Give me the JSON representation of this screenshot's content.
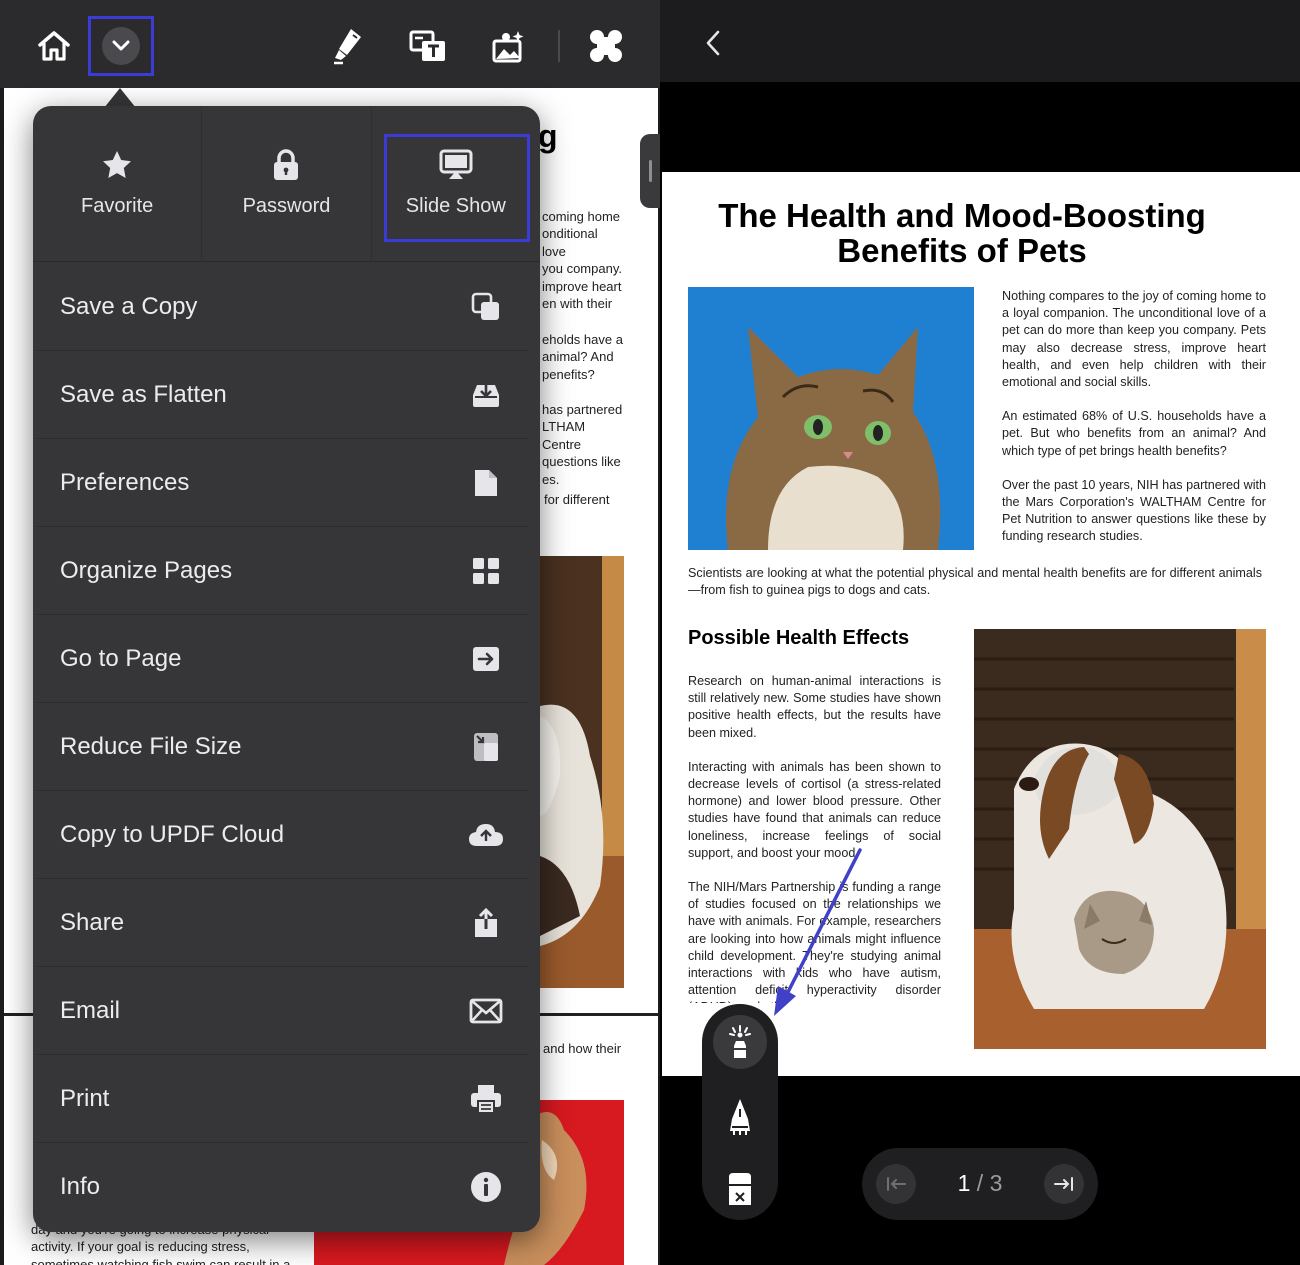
{
  "menu": {
    "top": [
      {
        "label": "Favorite",
        "icon": "star-icon"
      },
      {
        "label": "Password",
        "icon": "lock-icon"
      },
      {
        "label": "Slide Show",
        "icon": "slideshow-icon"
      }
    ],
    "items": [
      {
        "label": "Save a Copy",
        "icon": "copy-icon"
      },
      {
        "label": "Save as Flatten",
        "icon": "flatten-icon"
      },
      {
        "label": "Preferences",
        "icon": "document-icon"
      },
      {
        "label": "Organize Pages",
        "icon": "grid-icon"
      },
      {
        "label": "Go to Page",
        "icon": "go-to-page-icon"
      },
      {
        "label": "Reduce File Size",
        "icon": "reduce-size-icon"
      },
      {
        "label": "Copy to UPDF Cloud",
        "icon": "cloud-icon"
      },
      {
        "label": "Share",
        "icon": "share-icon"
      },
      {
        "label": "Email",
        "icon": "mail-icon"
      },
      {
        "label": "Print",
        "icon": "printer-icon"
      },
      {
        "label": "Info",
        "icon": "info-icon"
      }
    ]
  },
  "left_doc": {
    "heading_fragment": "g",
    "para1": [
      "coming home",
      "onditional love",
      "you company.",
      "improve heart",
      "en with their"
    ],
    "para2": [
      "eholds have a",
      "animal? And",
      "penefits?"
    ],
    "para3": [
      "has partnered",
      "LTHAM Centre",
      "questions like",
      "es."
    ],
    "para4": "for different",
    "para5": "and how their",
    "bottom1": "day and you're going to increase physical",
    "bottom2": "activity. If your goal is reducing stress,",
    "bottom3": "sometimes watching fish swim can result in a"
  },
  "document": {
    "title": "The Health and Mood-Boosting Benefits of Pets",
    "intro_paragraphs": [
      "Nothing compares to the joy of coming home to a loyal companion. The unconditional love of a pet can do more than keep you company. Pets may also decrease stress, improve heart health, and even help children with their emotional and social skills.",
      "An estimated 68% of U.S. households have a pet. But who benefits from an animal? And which type of pet brings health benefits?",
      "Over the past 10 years, NIH has partnered with the Mars Corporation's WALTHAM Centre for Pet Nutrition to answer questions like these by funding research studies."
    ],
    "scientists": "Scientists are looking at what the potential physical and mental health benefits are for different animals—from fish to guinea pigs to dogs and cats.",
    "section_heading": "Possible Health Effects",
    "section_paragraphs": [
      "Research on human-animal interactions is still relatively new. Some studies have shown positive health effects, but the results have been mixed.",
      "Interacting with animals has been shown to decrease levels of cortisol (a stress-related hormone) and lower blood pressure. Other studies have found that animals can reduce loneliness, increase feelings of social support, and boost your mood.",
      "The NIH/Mars Partnership is funding a range of studies focused on the relationships we have with animals. For example, researchers are looking into how animals might influence child development. They're studying animal interactions with kids who have autism, attention deficit hyperactivity disorder (ADHD), and other co"
    ]
  },
  "pager": {
    "current": "1",
    "separator": "/",
    "total": "3"
  },
  "colors": {
    "highlight": "#3b3bd6",
    "arrow": "#4040c8"
  }
}
